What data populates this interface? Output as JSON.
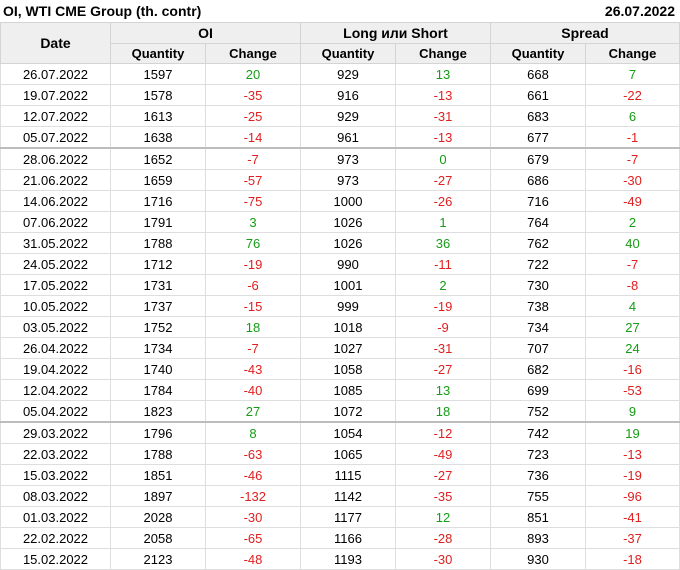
{
  "header": {
    "title": "OI, WTI CME Group (th. contr)",
    "date": "26.07.2022"
  },
  "columns": {
    "date": "Date",
    "groups": [
      "OI",
      "Long или Short",
      "Spread"
    ],
    "sub": [
      "Quantity",
      "Change",
      "Quantity",
      "Change",
      "Quantity",
      "Change"
    ]
  },
  "colors": {
    "positive": "#169c16",
    "negative": "#e02020"
  },
  "rows": [
    {
      "date": "26.07.2022",
      "oi_q": "1597",
      "oi_c": "20",
      "ls_q": "929",
      "ls_c": "13",
      "sp_q": "668",
      "sp_c": "7"
    },
    {
      "date": "19.07.2022",
      "oi_q": "1578",
      "oi_c": "-35",
      "ls_q": "916",
      "ls_c": "-13",
      "sp_q": "661",
      "sp_c": "-22"
    },
    {
      "date": "12.07.2022",
      "oi_q": "1613",
      "oi_c": "-25",
      "ls_q": "929",
      "ls_c": "-31",
      "sp_q": "683",
      "sp_c": "6"
    },
    {
      "date": "05.07.2022",
      "oi_q": "1638",
      "oi_c": "-14",
      "ls_q": "961",
      "ls_c": "-13",
      "sp_q": "677",
      "sp_c": "-1"
    },
    {
      "date": "28.06.2022",
      "oi_q": "1652",
      "oi_c": "-7",
      "ls_q": "973",
      "ls_c": "0",
      "sp_q": "679",
      "sp_c": "-7",
      "group_start": true
    },
    {
      "date": "21.06.2022",
      "oi_q": "1659",
      "oi_c": "-57",
      "ls_q": "973",
      "ls_c": "-27",
      "sp_q": "686",
      "sp_c": "-30"
    },
    {
      "date": "14.06.2022",
      "oi_q": "1716",
      "oi_c": "-75",
      "ls_q": "1000",
      "ls_c": "-26",
      "sp_q": "716",
      "sp_c": "-49"
    },
    {
      "date": "07.06.2022",
      "oi_q": "1791",
      "oi_c": "3",
      "ls_q": "1026",
      "ls_c": "1",
      "sp_q": "764",
      "sp_c": "2"
    },
    {
      "date": "31.05.2022",
      "oi_q": "1788",
      "oi_c": "76",
      "ls_q": "1026",
      "ls_c": "36",
      "sp_q": "762",
      "sp_c": "40"
    },
    {
      "date": "24.05.2022",
      "oi_q": "1712",
      "oi_c": "-19",
      "ls_q": "990",
      "ls_c": "-11",
      "sp_q": "722",
      "sp_c": "-7"
    },
    {
      "date": "17.05.2022",
      "oi_q": "1731",
      "oi_c": "-6",
      "ls_q": "1001",
      "ls_c": "2",
      "sp_q": "730",
      "sp_c": "-8"
    },
    {
      "date": "10.05.2022",
      "oi_q": "1737",
      "oi_c": "-15",
      "ls_q": "999",
      "ls_c": "-19",
      "sp_q": "738",
      "sp_c": "4"
    },
    {
      "date": "03.05.2022",
      "oi_q": "1752",
      "oi_c": "18",
      "ls_q": "1018",
      "ls_c": "-9",
      "sp_q": "734",
      "sp_c": "27"
    },
    {
      "date": "26.04.2022",
      "oi_q": "1734",
      "oi_c": "-7",
      "ls_q": "1027",
      "ls_c": "-31",
      "sp_q": "707",
      "sp_c": "24"
    },
    {
      "date": "19.04.2022",
      "oi_q": "1740",
      "oi_c": "-43",
      "ls_q": "1058",
      "ls_c": "-27",
      "sp_q": "682",
      "sp_c": "-16"
    },
    {
      "date": "12.04.2022",
      "oi_q": "1784",
      "oi_c": "-40",
      "ls_q": "1085",
      "ls_c": "13",
      "sp_q": "699",
      "sp_c": "-53"
    },
    {
      "date": "05.04.2022",
      "oi_q": "1823",
      "oi_c": "27",
      "ls_q": "1072",
      "ls_c": "18",
      "sp_q": "752",
      "sp_c": "9"
    },
    {
      "date": "29.03.2022",
      "oi_q": "1796",
      "oi_c": "8",
      "ls_q": "1054",
      "ls_c": "-12",
      "sp_q": "742",
      "sp_c": "19",
      "group_start": true
    },
    {
      "date": "22.03.2022",
      "oi_q": "1788",
      "oi_c": "-63",
      "ls_q": "1065",
      "ls_c": "-49",
      "sp_q": "723",
      "sp_c": "-13"
    },
    {
      "date": "15.03.2022",
      "oi_q": "1851",
      "oi_c": "-46",
      "ls_q": "1115",
      "ls_c": "-27",
      "sp_q": "736",
      "sp_c": "-19"
    },
    {
      "date": "08.03.2022",
      "oi_q": "1897",
      "oi_c": "-132",
      "ls_q": "1142",
      "ls_c": "-35",
      "sp_q": "755",
      "sp_c": "-96"
    },
    {
      "date": "01.03.2022",
      "oi_q": "2028",
      "oi_c": "-30",
      "ls_q": "1177",
      "ls_c": "12",
      "sp_q": "851",
      "sp_c": "-41"
    },
    {
      "date": "22.02.2022",
      "oi_q": "2058",
      "oi_c": "-65",
      "ls_q": "1166",
      "ls_c": "-28",
      "sp_q": "893",
      "sp_c": "-37"
    },
    {
      "date": "15.02.2022",
      "oi_q": "2123",
      "oi_c": "-48",
      "ls_q": "1193",
      "ls_c": "-30",
      "sp_q": "930",
      "sp_c": "-18"
    }
  ]
}
